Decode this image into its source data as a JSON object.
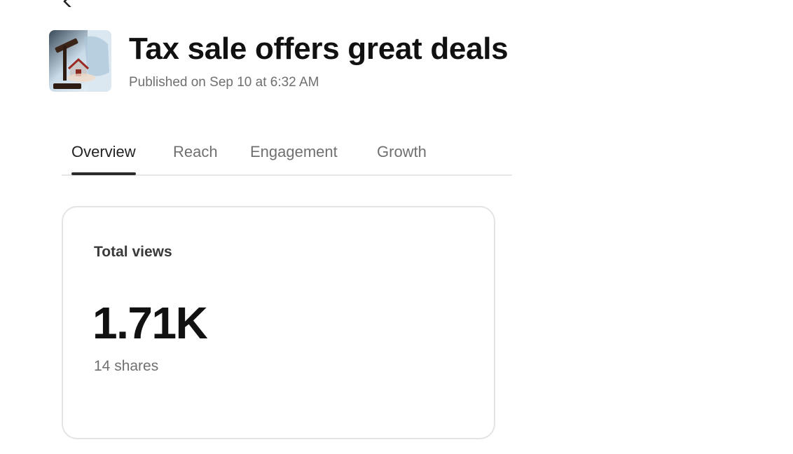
{
  "post": {
    "title": "Tax sale offers great deals",
    "published": "Published on Sep 10 at 6:32 AM",
    "thumbnail_icon": "gavel-house-image"
  },
  "tabs": [
    {
      "label": "Overview",
      "active": true
    },
    {
      "label": "Reach",
      "active": false
    },
    {
      "label": "Engagement",
      "active": false
    },
    {
      "label": "Growth",
      "active": false
    }
  ],
  "stats": {
    "label": "Total views",
    "value": "1.71K",
    "sub": "14 shares"
  },
  "colors": {
    "text_primary": "#111111",
    "text_secondary": "#707070",
    "tab_underline": "#2b2b2b",
    "card_border": "#e4e4e4"
  }
}
